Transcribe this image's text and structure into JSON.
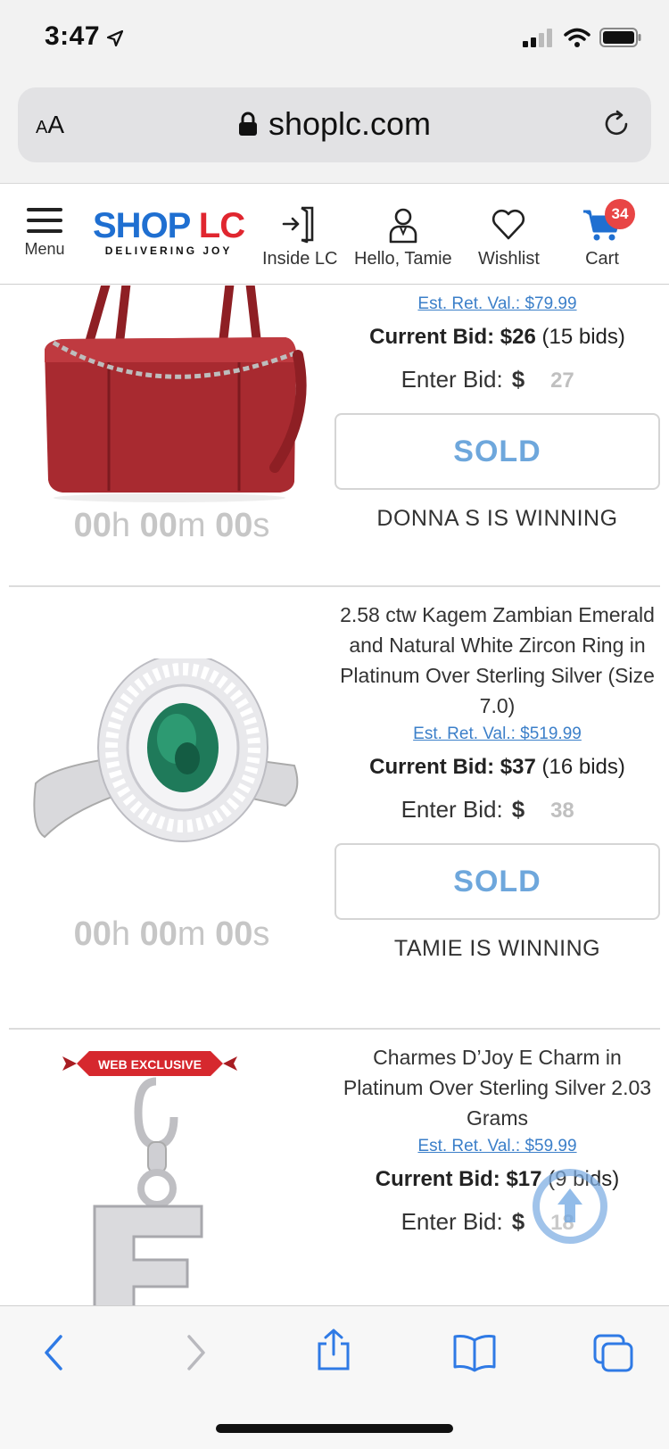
{
  "status": {
    "time": "3:47"
  },
  "browser": {
    "text_size_label_small": "A",
    "text_size_label_large": "A",
    "url": "shoplc.com"
  },
  "header": {
    "menu_label": "Menu",
    "logo_shop": "SHOP",
    "logo_lc": "LC",
    "logo_tagline": "DELIVERING JOY",
    "nav": [
      {
        "label": "Inside LC",
        "icon": "sign-in-icon"
      },
      {
        "label": "Hello, Tamie",
        "icon": "user-icon"
      },
      {
        "label": "Wishlist",
        "icon": "heart-icon"
      },
      {
        "label": "Cart",
        "icon": "cart-icon"
      }
    ],
    "cart_count": "34"
  },
  "items": [
    {
      "title": "",
      "image": "red-handbag-with-chain",
      "est_ret_val": "Est. Ret. Val.: $79.99",
      "current_bid_label": "Current Bid:",
      "current_bid": "$26",
      "bids": "(15 bids)",
      "enter_bid_label": "Enter Bid:",
      "currency": "$",
      "enter_bid_value": "27",
      "button": "SOLD",
      "status": "DONNA S IS WINNING",
      "timer": {
        "h": "00",
        "h_unit": "h",
        "m": "00",
        "m_unit": "m",
        "s": "00",
        "s_unit": "s"
      }
    },
    {
      "title": "2.58 ctw Kagem Zambian Emerald and Natural White Zircon Ring in Platinum Over Sterling Silver (Size 7.0)",
      "image": "emerald-ring",
      "est_ret_val": "Est. Ret. Val.: $519.99",
      "current_bid_label": "Current Bid:",
      "current_bid": "$37",
      "bids": "(16 bids)",
      "enter_bid_label": "Enter Bid:",
      "currency": "$",
      "enter_bid_value": "38",
      "button": "SOLD",
      "status": "TAMIE IS WINNING",
      "timer": {
        "h": "00",
        "h_unit": "h",
        "m": "00",
        "m_unit": "m",
        "s": "00",
        "s_unit": "s"
      }
    },
    {
      "title": "Charmes D’Joy E Charm in Platinum Over Sterling Silver 2.03 Grams",
      "image": "letter-e-charm",
      "ribbon": "WEB EXCLUSIVE",
      "est_ret_val": "Est. Ret. Val.: $59.99",
      "current_bid_label": "Current Bid:",
      "current_bid": "$17",
      "bids": "(9 bids)",
      "enter_bid_label": "Enter Bid:",
      "currency": "$",
      "enter_bid_value": "18"
    }
  ],
  "colors": {
    "brand_blue": "#1f6fd1",
    "brand_red": "#e0262f",
    "sold_blue": "#6ea7dc",
    "link_blue": "#3b7fc9"
  }
}
